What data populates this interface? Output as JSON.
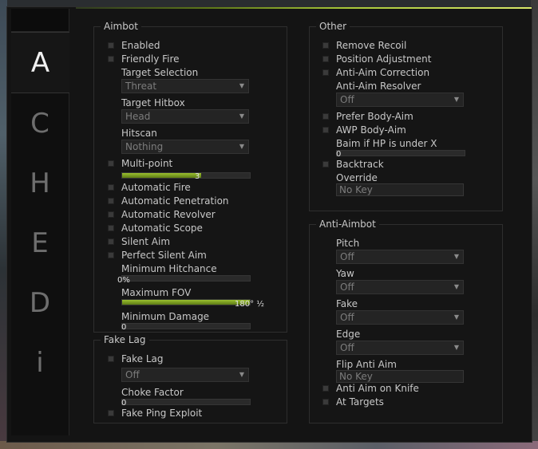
{
  "tabs": [
    "A",
    "C",
    "H",
    "E",
    "D",
    "i"
  ],
  "aimbot": {
    "title": "Aimbot",
    "enabled": "Enabled",
    "friendly_fire": "Friendly Fire",
    "target_selection": {
      "label": "Target Selection",
      "value": "Threat"
    },
    "target_hitbox": {
      "label": "Target Hitbox",
      "value": "Head"
    },
    "hitscan": {
      "label": "Hitscan",
      "value": "Nothing"
    },
    "multipoint": {
      "label": "Multi-point",
      "value": "3",
      "fill": 0.62
    },
    "auto_fire": "Automatic  Fire",
    "auto_penetration": "Automatic  Penetration",
    "auto_revolver": "Automatic  Revolver",
    "auto_scope": "Automatic  Scope",
    "silent_aim": "Silent Aim",
    "perfect_silent_aim": "Perfect Silent Aim",
    "min_hitchance": {
      "label": "Minimum Hitchance",
      "value": "0%",
      "fill": 0
    },
    "max_fov": {
      "label": "Maximum FOV",
      "value": "180° ½",
      "fill": 1.0
    },
    "min_damage": {
      "label": "Minimum Damage",
      "value": "0",
      "fill": 0
    }
  },
  "fakelag": {
    "title": "Fake Lag",
    "fake_lag": "Fake Lag",
    "mode": {
      "value": "Off"
    },
    "choke": {
      "label": "Choke Factor",
      "value": "0",
      "fill": 0
    },
    "fake_ping": "Fake Ping Exploit"
  },
  "other": {
    "title": "Other",
    "remove_recoil": "Remove Recoil",
    "position_adjustment": "Position Adjustment",
    "anti_aim_correction": "Anti-Aim Correction",
    "resolver": {
      "label": "Anti-Aim Resolver",
      "value": "Off"
    },
    "prefer_body_aim": "Prefer Body-Aim",
    "awp_body_aim": "AWP Body-Aim",
    "baim_hp": {
      "label": "Baim if HP is under X",
      "value": "0",
      "fill": 0
    },
    "backtrack": "Backtrack",
    "override": {
      "label": "Override",
      "value": "No Key"
    }
  },
  "antiaim": {
    "title": "Anti-Aimbot",
    "pitch": {
      "label": "Pitch",
      "value": "Off"
    },
    "yaw": {
      "label": "Yaw",
      "value": "Off"
    },
    "fake": {
      "label": "Fake",
      "value": "Off"
    },
    "edge": {
      "label": "Edge",
      "value": "Off"
    },
    "flip": {
      "label": "Flip Anti Aim",
      "value": "No Key"
    },
    "on_knife": "Anti Aim on Knife",
    "at_targets": "At Targets"
  },
  "colors": {
    "accent": "#9ac030"
  },
  "icons": {
    "dropdown": "chevron-down-icon"
  }
}
